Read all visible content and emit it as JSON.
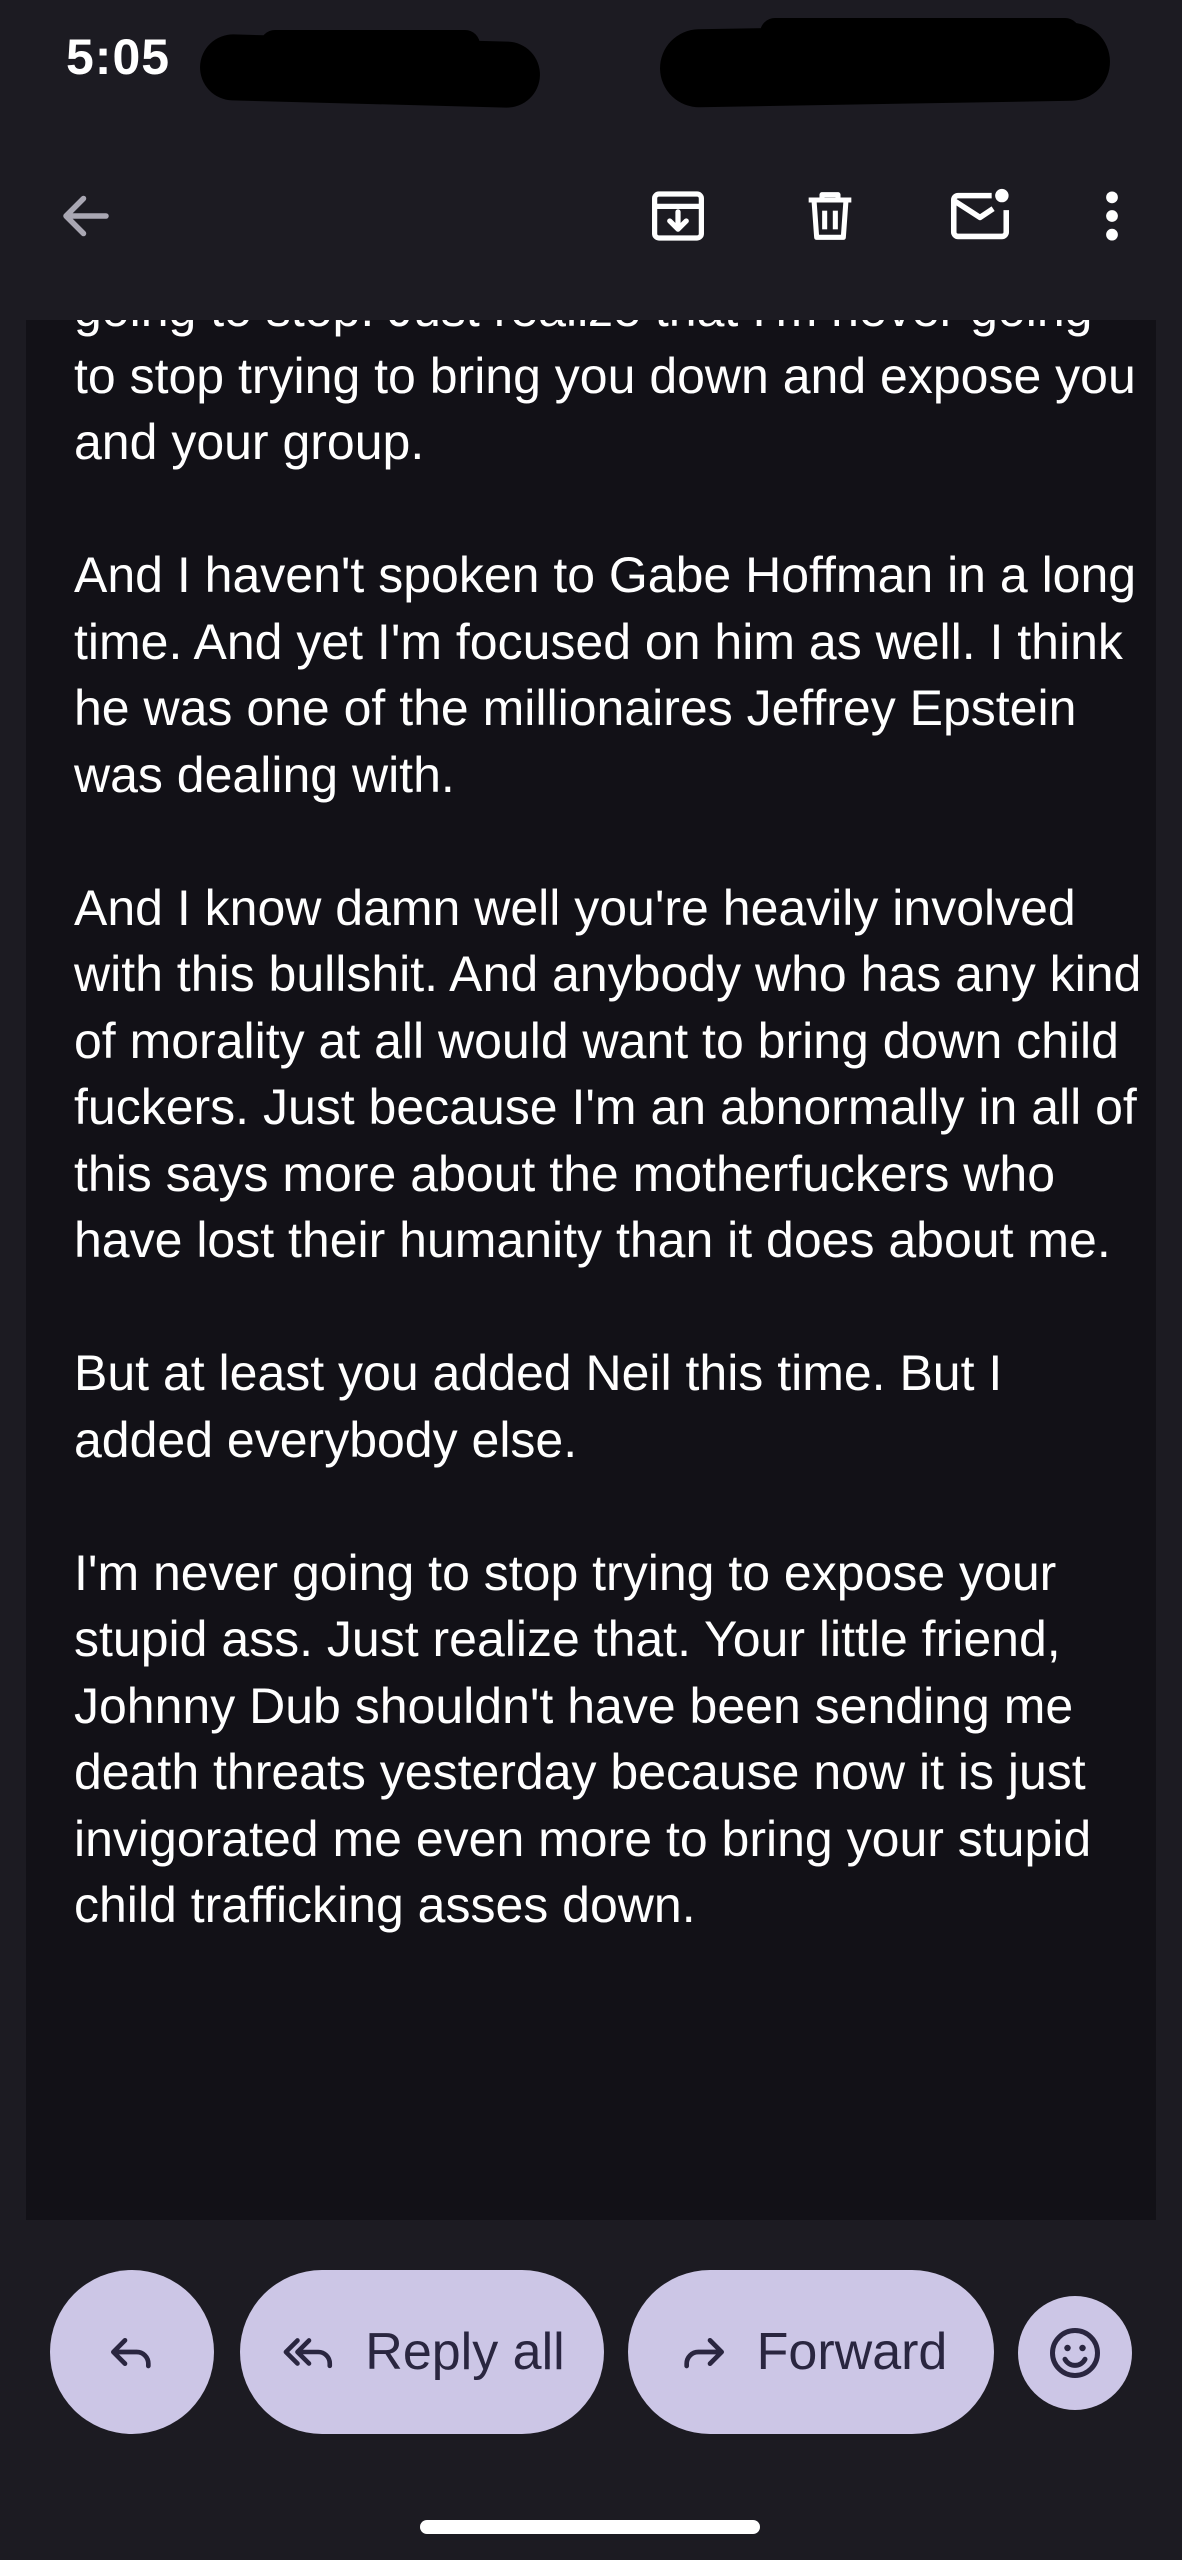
{
  "status_bar": {
    "time": "5:05"
  },
  "toolbar": {
    "back_icon": "arrow-left-icon",
    "archive_icon": "archive-icon",
    "delete_icon": "trash-icon",
    "mark_unread_icon": "mail-unread-icon",
    "more_icon": "more-vertical-icon"
  },
  "message": {
    "paragraphs": [
      "going to stop. Just realize that I'm never going to stop trying to bring you down and expose you and your group.",
      "And I haven't spoken to Gabe Hoffman in a long time. And yet I'm focused on him as well. I think he was one of the millionaires Jeffrey Epstein was dealing with.",
      "And I know damn well you're heavily involved with this bullshit. And anybody who has any kind of morality at all would want to bring down child fuckers. Just because I'm an abnormally in all of this says more about the motherfuckers who have lost their humanity than it does about me.",
      "But at least you added Neil this time. But I added everybody else.",
      "I'm never going to stop trying to expose your stupid ass. Just realize that. Your little friend, Johnny Dub shouldn't have been sending me death threats yesterday because now it is just invigorated me even more to bring your stupid child trafficking asses down."
    ]
  },
  "actions": {
    "reply_icon": "reply-icon",
    "reply_all_label": "Reply all",
    "reply_all_icon": "reply-all-icon",
    "forward_label": "Forward",
    "forward_icon": "forward-icon",
    "emoji_icon": "emoji-icon"
  },
  "colors": {
    "background": "#1c1b22",
    "message_panel": "#121117",
    "pill": "#ccc6e6",
    "pill_text": "#2a2640"
  }
}
